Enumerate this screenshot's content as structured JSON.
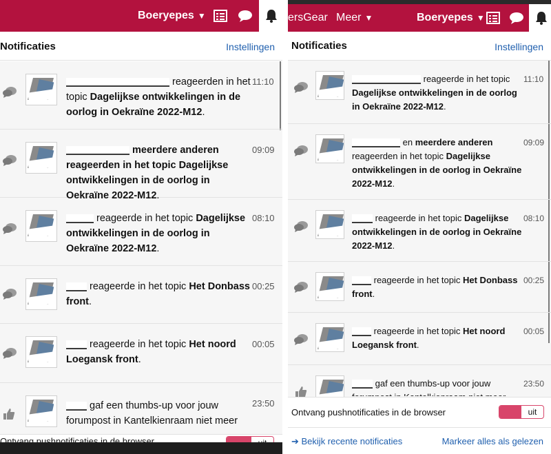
{
  "left": {
    "nav": {
      "user": "Boeryepes"
    },
    "header": {
      "title": "Notificaties",
      "settings_link": "Instellingen"
    },
    "items": [
      {
        "kind": "chat",
        "user": "",
        "text_before": "reageerden in het topic ",
        "topic": "Dagelijkse ontwikkelingen in de oorlog in Oekraïne 2022-M12",
        "suffix": ".",
        "time": "11:10"
      },
      {
        "kind": "chat",
        "user": "",
        "text_before": "meerdere anderen reageerden in het topic ",
        "topic": "Dagelijkse ontwikkelingen in de oorlog in Oekraïne 2022-M12",
        "suffix": ".",
        "time": "09:09"
      },
      {
        "kind": "chat",
        "user": "",
        "text_before": "reageerde in het topic ",
        "topic": "Dagelijkse ontwikkelingen in de oorlog in Oekraïne 2022-M12",
        "suffix": ".",
        "time": "08:10"
      },
      {
        "kind": "chat",
        "user": "",
        "text_before": "reageerde in het topic ",
        "topic": "Het Donbass front",
        "suffix": ".",
        "time": "00:25"
      },
      {
        "kind": "chat",
        "user": "",
        "text_before": "reageerde in het topic ",
        "topic": "Het noord Loegansk front",
        "suffix": ".",
        "time": "00:05"
      },
      {
        "kind": "thumb",
        "user": "",
        "text_before": "gaf een thumbs-up voor jouw forumpost in Kantelkienraam niet meer dicht",
        "topic": "",
        "suffix": "",
        "time": "23:50"
      }
    ],
    "push": {
      "label": "Ontvang pushnotificaties in de browser",
      "toggle": "uit"
    }
  },
  "right": {
    "nav": {
      "brand_partial": "ersGear",
      "more": "Meer",
      "user": "Boeryepes"
    },
    "header": {
      "title": "Notificaties",
      "settings_link": "Instellingen"
    },
    "items": [
      {
        "kind": "chat",
        "user": "",
        "text_before": "reageerde in het topic ",
        "topic": "Dagelijkse ontwikkelingen in de oorlog in Oekraïne 2022-M12",
        "suffix": ".",
        "time": "11:10"
      },
      {
        "kind": "chat",
        "user": "",
        "text_before": "en ",
        "topic_pre": "meerdere anderen",
        "text_mid": " reageerden in het topic ",
        "topic": "Dagelijkse ontwikkelingen in de oorlog in Oekraïne 2022-M12",
        "suffix": ".",
        "time": "09:09"
      },
      {
        "kind": "chat",
        "user": "",
        "text_before": "reageerde in het topic ",
        "topic": "Dagelijkse ontwikkelingen in de oorlog in Oekraïne 2022-M12",
        "suffix": ".",
        "time": "08:10"
      },
      {
        "kind": "chat",
        "user": "",
        "text_before": "reageerde in het topic ",
        "topic": "Het Donbass front",
        "suffix": ".",
        "time": "00:25"
      },
      {
        "kind": "chat",
        "user": "",
        "text_before": "reageerde in het topic ",
        "topic": "Het noord Loegansk front",
        "suffix": ".",
        "time": "00:05"
      },
      {
        "kind": "thumb",
        "user": "",
        "text_before": "gaf een thumbs-up voor jouw forumpost in Kantelkienraam niet meer dicht",
        "topic": "",
        "suffix": "",
        "time": "23:50"
      }
    ],
    "push": {
      "label": "Ontvang pushnotificaties in de browser",
      "toggle": "uit"
    },
    "footer": {
      "recent_link": "Bekijk recente notificaties",
      "mark_all_link": "Markeer alles als gelezen"
    }
  },
  "colors": {
    "navbar": "#b3123e",
    "link": "#1f5fae",
    "toggle": "#d8456a"
  },
  "icons": [
    "chevron-down-icon",
    "list-icon",
    "chat-icon",
    "bell-icon",
    "thumbs-up-icon",
    "arrow-right-icon"
  ]
}
